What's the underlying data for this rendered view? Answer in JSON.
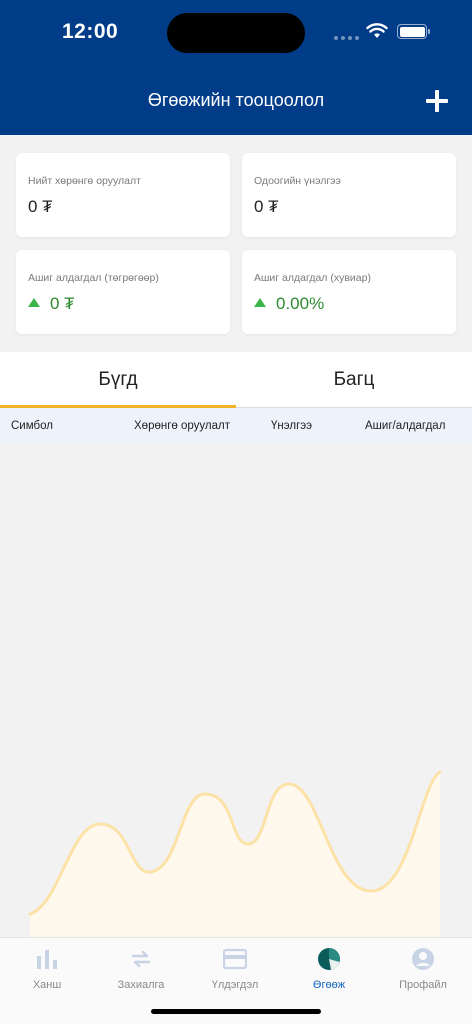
{
  "status": {
    "time": "12:00"
  },
  "header": {
    "title": "Өгөөжийн тооцоолол"
  },
  "cards": [
    {
      "label": "Нийт хөрөнгө оруулалт",
      "value": "0 ₮"
    },
    {
      "label": "Одоогийн үнэлгээ",
      "value": "0 ₮"
    },
    {
      "label": "Ашиг алдагдал (төгрөгөөр)",
      "value": "0 ₮"
    },
    {
      "label": "Ашиг алдагдал (хувиар)",
      "value": "0.00%"
    }
  ],
  "tabs": [
    {
      "label": "Бүгд",
      "active": true
    },
    {
      "label": "Багц",
      "active": false
    }
  ],
  "table": {
    "columns": [
      "Симбол",
      "Хөрөнгө оруулалт",
      "Үнэлгээ",
      "Ашиг/алдагдал"
    ]
  },
  "colors": {
    "accent": "#003c87",
    "tab_indicator": "#f0b429",
    "positive": "#2e8b2e",
    "chart_line": "#fde2a8"
  },
  "nav": [
    {
      "label": "Ханш",
      "icon": "bar-chart-icon"
    },
    {
      "label": "Захиалга",
      "icon": "swap-icon"
    },
    {
      "label": "Үлдэгдэл",
      "icon": "card-icon"
    },
    {
      "label": "Өгөөж",
      "icon": "pie-chart-icon",
      "active": true
    },
    {
      "label": "Профайл",
      "icon": "user-icon"
    }
  ]
}
